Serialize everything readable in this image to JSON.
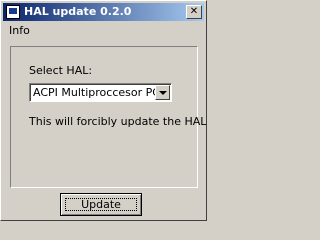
{
  "window": {
    "title": "HAL update 0.2.0",
    "close_symbol": "✕",
    "app_icon": "computer-icon"
  },
  "menubar": {
    "items": [
      "Info"
    ]
  },
  "form": {
    "select_label": "Select HAL:",
    "select_value": "ACPI Multiproccesor PC",
    "warning_text": "This will forcibly update the HAL",
    "update_button_label": "Update"
  }
}
